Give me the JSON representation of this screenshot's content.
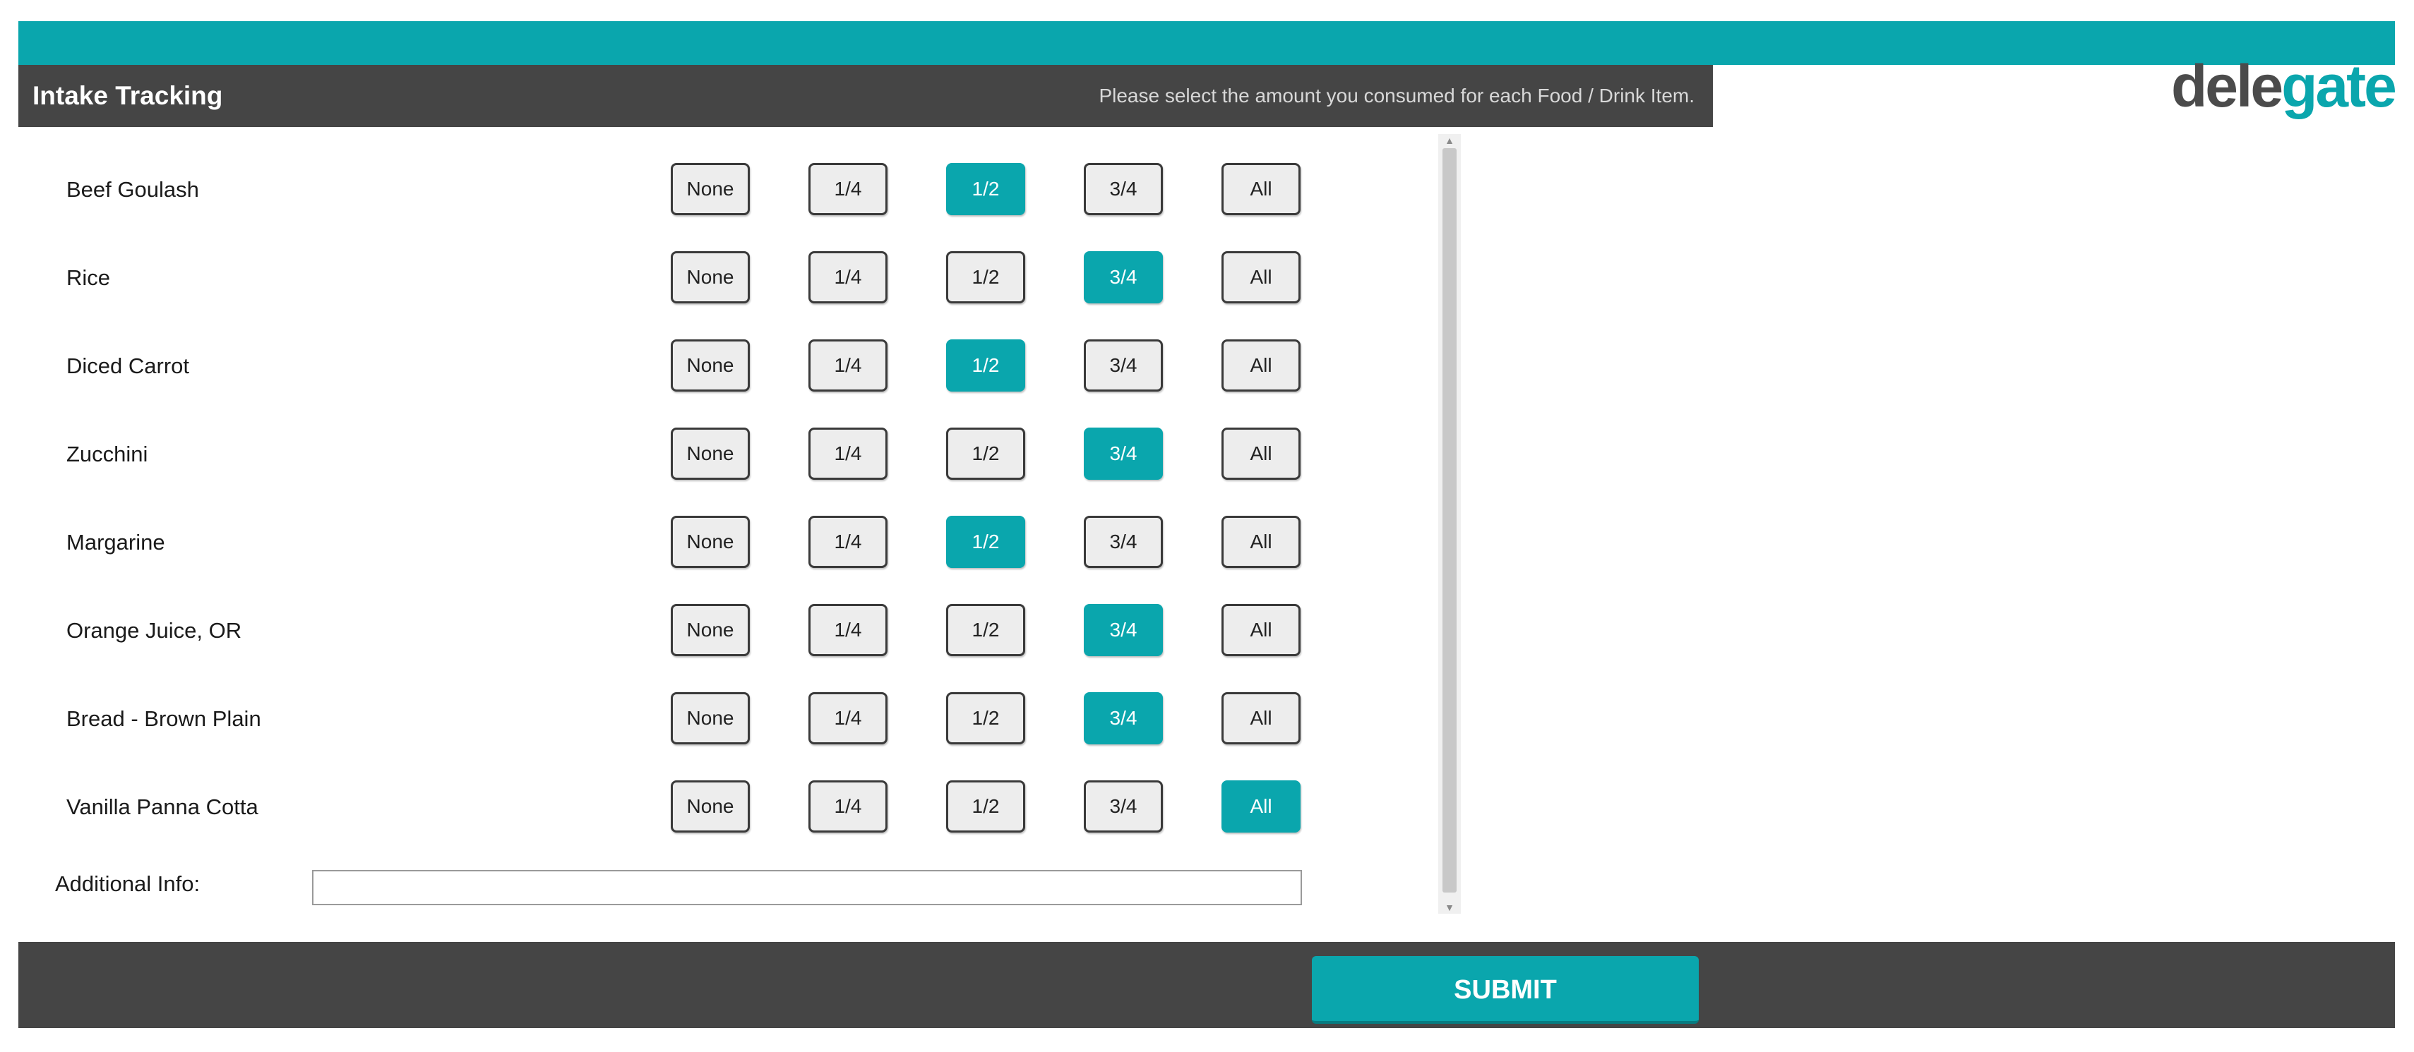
{
  "header": {
    "title": "Intake Tracking",
    "instruction": "Please select the amount you consumed for each Food / Drink Item.",
    "logo": {
      "part1": "dele",
      "part2": "gate"
    }
  },
  "colors": {
    "accent": "#0aa6ad",
    "header_bg": "#454545",
    "button_bg": "#ededed"
  },
  "options": [
    "None",
    "1/4",
    "1/2",
    "3/4",
    "All"
  ],
  "items": [
    {
      "name": "Beef Goulash",
      "selected": "1/2"
    },
    {
      "name": "Rice",
      "selected": "3/4"
    },
    {
      "name": "Diced Carrot",
      "selected": "1/2"
    },
    {
      "name": "Zucchini",
      "selected": "3/4"
    },
    {
      "name": "Margarine",
      "selected": "1/2"
    },
    {
      "name": "Orange Juice, OR",
      "selected": "3/4"
    },
    {
      "name": "Bread - Brown Plain",
      "selected": "3/4"
    },
    {
      "name": "Vanilla Panna Cotta",
      "selected": "All"
    }
  ],
  "additional_info": {
    "label": "Additional Info:",
    "value": ""
  },
  "footer": {
    "submit_label": "SUBMIT"
  }
}
